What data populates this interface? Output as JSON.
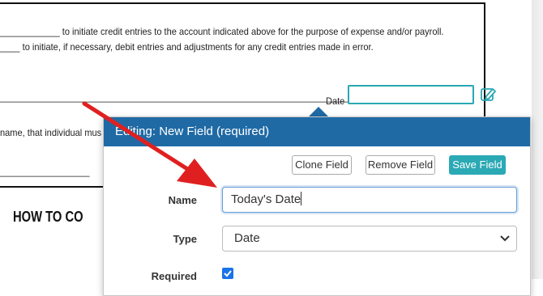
{
  "document": {
    "line1": "____________ to initiate credit entries to the account indicated above for the purpose of expense and/or payroll.",
    "line2": "____ to initiate, if necessary, debit entries and adjustments for any credit entries made in error.",
    "line3_rule": "______________________________________________________________________________________",
    "date_label": "Date",
    "line4": "name, that individual mus",
    "line5_rule": "__________________",
    "heading": "HOW TO CO"
  },
  "popover": {
    "title": "Editing: New Field (required)",
    "buttons": {
      "clone": "Clone Field",
      "remove": "Remove Field",
      "save": "Save Field"
    },
    "name_label": "Name",
    "name_value": "Today's Date",
    "type_label": "Type",
    "type_value": "Date",
    "required_label": "Required",
    "required_checked": true
  },
  "colors": {
    "header": "#1f6aa5",
    "primary_button": "#2ba9b4",
    "field_border": "#2aa8b2",
    "annotation_arrow": "#e02020"
  }
}
